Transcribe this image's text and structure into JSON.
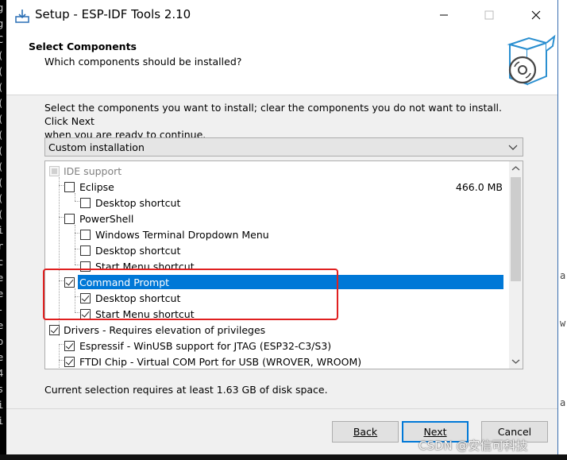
{
  "window": {
    "title": "Setup - ESP-IDF Tools 2.10"
  },
  "header": {
    "title": "Select Components",
    "subtitle": "Which components should be installed?"
  },
  "instructions": {
    "line1": "Select the components you want to install; clear the components you do not want to install. Click Next",
    "line2": "when you are ready to continue."
  },
  "install_type": {
    "selected": "Custom installation"
  },
  "components": [
    {
      "label": "IDE support",
      "checked": "partial",
      "disabled": true
    },
    {
      "label": "Eclipse",
      "checked": false,
      "size": "466.0 MB"
    },
    {
      "label": "Desktop shortcut",
      "checked": false
    },
    {
      "label": "PowerShell",
      "checked": false
    },
    {
      "label": "Windows Terminal Dropdown Menu",
      "checked": false
    },
    {
      "label": "Desktop shortcut",
      "checked": false
    },
    {
      "label": "Start Menu shortcut",
      "checked": false
    },
    {
      "label": "Command Prompt",
      "checked": true,
      "selected": true
    },
    {
      "label": "Desktop shortcut",
      "checked": true
    },
    {
      "label": "Start Menu shortcut",
      "checked": true
    },
    {
      "label": "Drivers - Requires elevation of privileges",
      "checked": true
    },
    {
      "label": "Espressif - WinUSB support for JTAG (ESP32-C3/S3)",
      "checked": true
    },
    {
      "label": "FTDI Chip - Virtual COM Port for USB (WROVER, WROOM)",
      "checked": true
    }
  ],
  "disk_info": "Current selection requires at least 1.63 GB of disk space.",
  "buttons": {
    "back": "Back",
    "next": "Next",
    "cancel": "Cancel"
  },
  "watermark": "CSDN @安信可科技",
  "colors": {
    "selection": "#0078d7",
    "highlight_box": "#e02020"
  }
}
